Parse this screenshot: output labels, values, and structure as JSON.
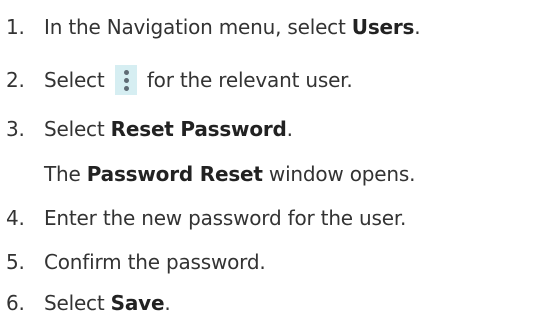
{
  "steps": [
    {
      "num": "1.",
      "text_before": "In the Navigation menu, select ",
      "bold": "Users",
      "text_after": "."
    },
    {
      "num": "2.",
      "text_before": "Select ",
      "icon": "more-vertical-icon",
      "text_after": " for the relevant user."
    },
    {
      "num": "3.",
      "text_before": "Select ",
      "bold": "Reset Password",
      "text_after": "."
    },
    {
      "note_before": "The ",
      "note_bold": "Password Reset",
      "note_after": " window opens."
    },
    {
      "num": "4.",
      "text": "Enter the new password for the user."
    },
    {
      "num": "5.",
      "text": "Confirm the password."
    },
    {
      "num": "6.",
      "text_before": "Select ",
      "bold": "Save",
      "text_after": "."
    }
  ],
  "colors": {
    "text": "#333333",
    "icon_background": "#d6eef2",
    "icon_dots": "#5f6b75"
  }
}
